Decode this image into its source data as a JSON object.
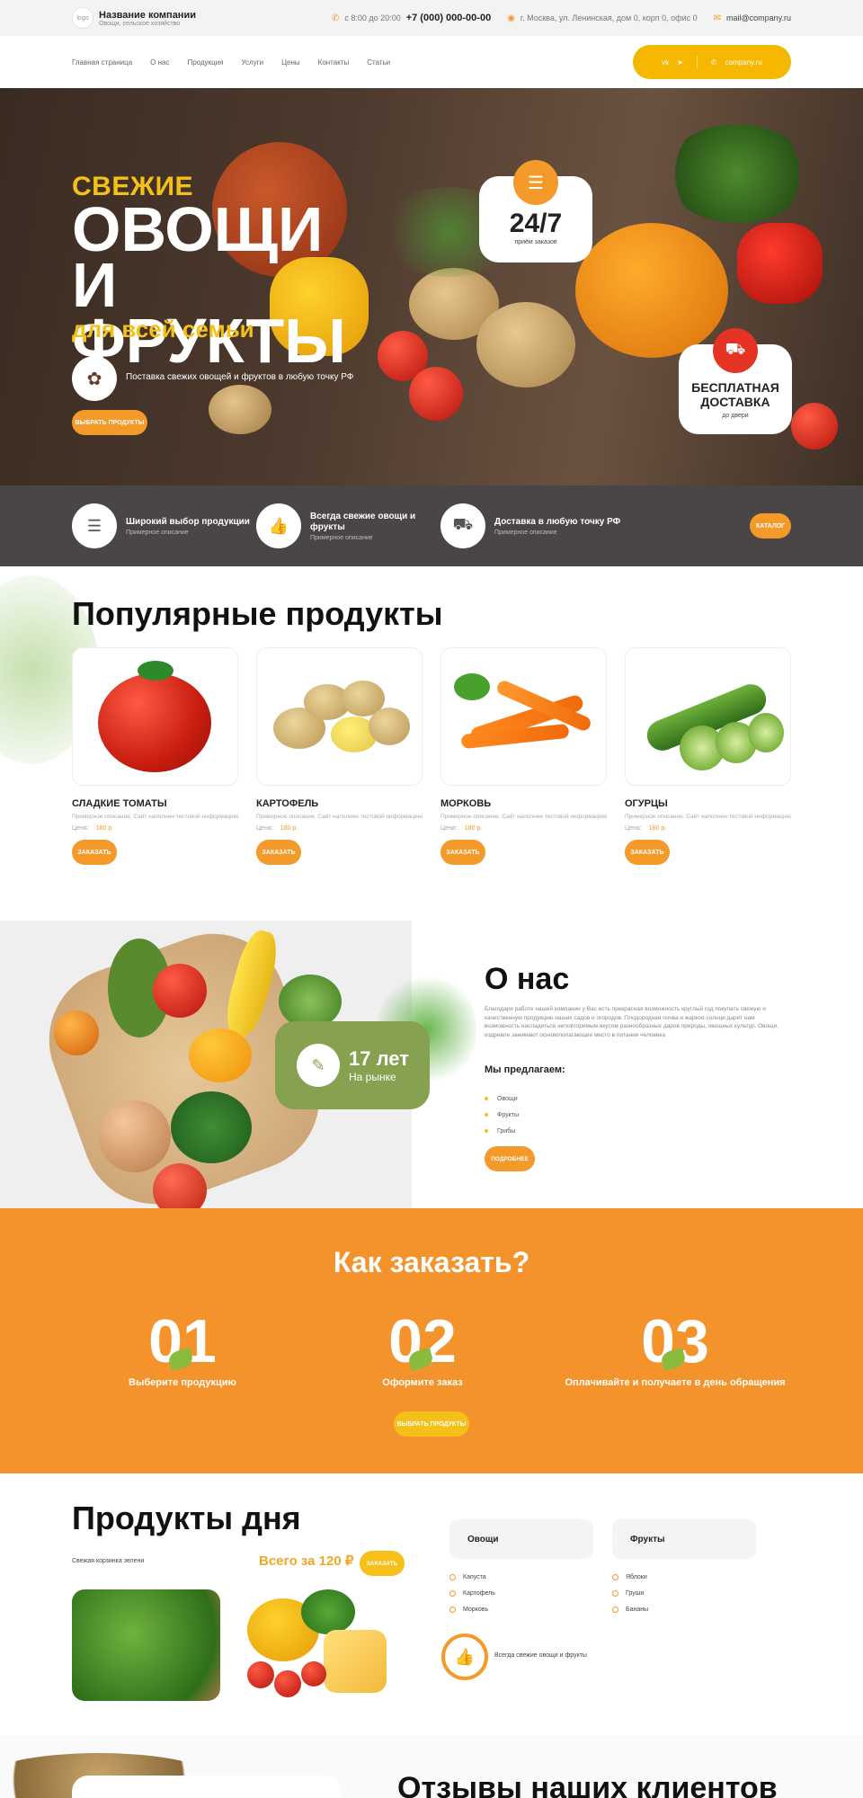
{
  "header": {
    "logo_text": "logo",
    "company_name": "Название компании",
    "company_sub": "Овощи, сельское хозяйство",
    "hours": "с 8:00 до 20:00",
    "phone": "+7 (000) 000-00-00",
    "address": "г. Москва, ул. Ленинская, дом 0, корп 0, офис 0",
    "email": "mail@company.ru"
  },
  "nav": {
    "items": [
      "Главная страница",
      "О нас",
      "Продукция",
      "Услуги",
      "Цены",
      "Контакты",
      "Статьи"
    ],
    "social_site": "company.ru"
  },
  "hero": {
    "small_title": "СВЕЖИЕ",
    "big_title": "ОВОЩИ И ФРУКТЫ",
    "subtitle": "для всей семьи",
    "text": "Поставка свежих овощей и фруктов в любую точку РФ",
    "button": "ВЫБРАТЬ ПРОДУКТЫ",
    "badge_hours_title": "24/7",
    "badge_hours_sub": "приём заказов",
    "badge_delivery_title": "БЕСПЛАТНАЯ ДОСТАВКА",
    "badge_delivery_sub": "до двери"
  },
  "features": {
    "items": [
      {
        "title": "Широкий выбор продукции",
        "sub": "Примерное описание"
      },
      {
        "title": "Всегда свежие овощи и фрукты",
        "sub": "Примерное описание"
      },
      {
        "title": "Доставка в любую точку РФ",
        "sub": "Примерное описание"
      }
    ],
    "catalog_button": "КАТАЛОГ"
  },
  "popular": {
    "title": "Популярные продукты",
    "price_label": "Цена:",
    "order_button": "ЗАКАЗАТЬ",
    "products": [
      {
        "name": "СЛАДКИЕ ТОМАТЫ",
        "desc": "Примерное описание. Сайт наполнен тестовой информацией",
        "price": "180 р."
      },
      {
        "name": "КАРТОФЕЛЬ",
        "desc": "Примерное описание. Сайт наполнен тестовой информацией",
        "price": "180 р."
      },
      {
        "name": "МОРКОВЬ",
        "desc": "Примерное описание. Сайт наполнен тестовой информацией",
        "price": "180 р."
      },
      {
        "name": "ОГУРЦЫ",
        "desc": "Примерное описание. Сайт наполнен тестовой информацией",
        "price": "180 р."
      }
    ]
  },
  "about": {
    "years_number": "17 лет",
    "years_text": "На рынке",
    "title": "О нас",
    "text": "Благодаря работе нашей компании у Вас есть прекрасная возможность круглый год покупать свежую и качественную продукцию наших садов и огородов. Плодородная почва и жаркое солнце дарят нам возможность насладиться неповторимым вкусом разнообразных даров природы, овощных культур. Овощи, издревле занимают основополагающее место в питании человека",
    "offer_title": "Мы предлагаем:",
    "offer_items": [
      "Овощи",
      "Фрукты",
      "Грибы"
    ],
    "button": "ПОДРОБНЕЕ"
  },
  "how": {
    "title": "Как заказать?",
    "steps": [
      {
        "num": "01",
        "text": "Выберите продукцию"
      },
      {
        "num": "02",
        "text": "Оформите заказ"
      },
      {
        "num": "03",
        "text": "Оплачивайте и получаете в день обращения"
      }
    ],
    "button": "ВЫБРАТЬ ПРОДУКТЫ"
  },
  "day": {
    "title": "Продукты дня",
    "basket": "Свежая корзинка зелени",
    "total": "Всего за 120 ₽",
    "button": "ЗАКАЗАТЬ",
    "cat1": {
      "title": "Овощи",
      "items": [
        "Капуста",
        "Картофель",
        "Морковь"
      ]
    },
    "cat2": {
      "title": "Фрукты",
      "items": [
        "Яблоки",
        "Груши",
        "Бананы"
      ]
    },
    "fresh_text": "Всегда свежие овощи и фрукты"
  },
  "reviews": {
    "title": "Отзывы наших клиентов"
  },
  "colors": {
    "accent": "#f39a2a",
    "yellow": "#f5c118",
    "green": "#86a14f",
    "dark": "#4a4646"
  },
  "icons": [
    "phone-icon",
    "location-icon",
    "mail-icon",
    "whatsapp-icon",
    "vk-icon",
    "telegram-icon",
    "clipboard-icon",
    "truck-icon",
    "broccoli-icon",
    "thumbs-up-icon",
    "certificate-icon"
  ]
}
